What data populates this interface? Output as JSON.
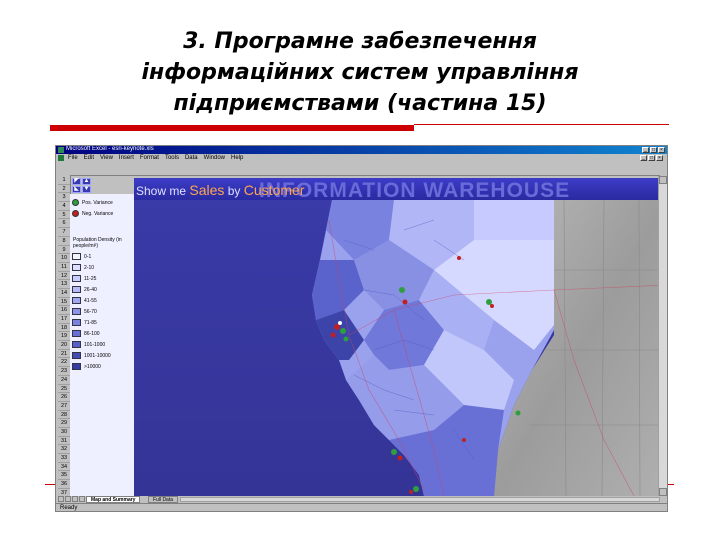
{
  "slide": {
    "title_lines": [
      "3. Програмне забезпечення",
      "інформаційних систем  управління",
      "підприємствами (частина 15)"
    ]
  },
  "window": {
    "title": "Microsoft Excel - esri-keynote.xls",
    "menu": [
      "File",
      "Edit",
      "View",
      "Insert",
      "Format",
      "Tools",
      "Data",
      "Window",
      "Help"
    ]
  },
  "rows": [
    "1",
    "2",
    "3",
    "4",
    "5",
    "6",
    "7",
    "8",
    "9",
    "10",
    "11",
    "12",
    "13",
    "14",
    "15",
    "16",
    "17",
    "18",
    "19",
    "20",
    "21",
    "22",
    "23",
    "24",
    "25",
    "26",
    "27",
    "28",
    "29",
    "30",
    "31",
    "32",
    "33",
    "34",
    "35",
    "36",
    "37"
  ],
  "banner": {
    "show_me": "Show me",
    "sales": "Sales",
    "by": "by",
    "customer": "Customer",
    "background_text": "INFORMATION WAREHOUSE"
  },
  "legend": {
    "pos_variance": "Pos. Variance",
    "neg_variance": "Neg. Variance",
    "density_header": "Population Density (in people/mi²)",
    "classes": [
      "0-1",
      "2-10",
      "11-25",
      "26-40",
      "41-55",
      "56-70",
      "71-85",
      "86-100",
      "101-1000",
      "1001-10000",
      ">10000"
    ],
    "colors": [
      "#f4f5ff",
      "#dcdfff",
      "#c8ccff",
      "#b4b9f8",
      "#a0a6f0",
      "#8d94e8",
      "#7a82e0",
      "#6870d6",
      "#565ec8",
      "#444cb6",
      "#333aa0"
    ],
    "pos_color": "#2e9e3e",
    "neg_color": "#c02020"
  },
  "sheets": {
    "active": "Map and Summary",
    "other": "Full Data"
  },
  "status": "Ready"
}
